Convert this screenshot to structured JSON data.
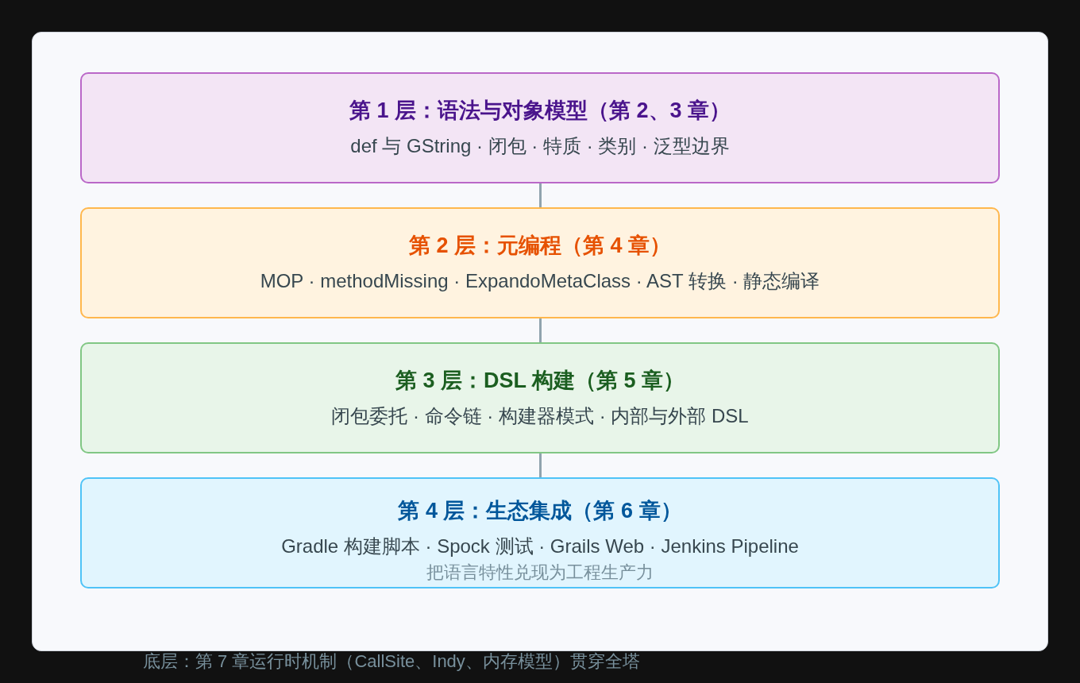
{
  "layers": [
    {
      "title": "第 1 层：语法与对象模型（第 2、3 章）",
      "items": "def 与 GString · 闭包 · 特质 · 类别 · 泛型边界",
      "color": "#ba68c8"
    },
    {
      "title": "第 2 层：元编程（第 4 章）",
      "items": "MOP · methodMissing · ExpandoMetaClass · AST 转换 · 静态编译",
      "color": "#ffb74d"
    },
    {
      "title": "第 3 层：DSL 构建（第 5 章）",
      "items": "闭包委托 · 命令链 · 构建器模式 · 内部与外部 DSL",
      "color": "#81c784"
    },
    {
      "title": "第 4 层：生态集成（第 6 章）",
      "items": "Gradle 构建脚本 · Spock 测试 · Grails Web · Jenkins Pipeline",
      "note": "把语言特性兑现为工程生产力",
      "color": "#4fc3f7"
    }
  ],
  "footer": "底层：第 7 章运行时机制（CallSite、Indy、内存模型）贯穿全塔"
}
